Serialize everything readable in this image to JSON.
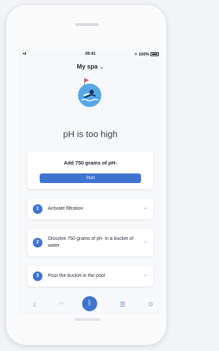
{
  "status_bar": {
    "signal": "•ıl ",
    "time": "09:41",
    "battery_text": "✈ 100%"
  },
  "header": {
    "title": "My spa",
    "chevron_icon": "chevron-down-icon"
  },
  "status": {
    "title": "pH is too high",
    "illustration": "swimmer-flag-illustration"
  },
  "action": {
    "title": "Add 750 grams of pH-",
    "button_label": "Start"
  },
  "steps": [
    {
      "number": "1",
      "label": "Activate filtration"
    },
    {
      "number": "2",
      "label": "Dissolve 750 grams of ph- in a bucket of water"
    },
    {
      "number": "3",
      "label": "Pour the bucket in the pool"
    }
  ],
  "tabbar": {
    "items": [
      {
        "icon": "pool-ladder-icon",
        "glyph": "⫫",
        "active": false
      },
      {
        "icon": "gauge-icon",
        "glyph": "◠",
        "active": false
      },
      {
        "icon": "bluetooth-icon",
        "glyph": "ᛒ",
        "active": true
      },
      {
        "icon": "list-icon",
        "glyph": "☰",
        "active": false
      },
      {
        "icon": "settings-gear-icon",
        "glyph": "⚙",
        "active": false
      }
    ]
  },
  "colors": {
    "accent": "#3f73d0",
    "hero_circle": "#55a7e6",
    "flag": "#e6604a"
  }
}
